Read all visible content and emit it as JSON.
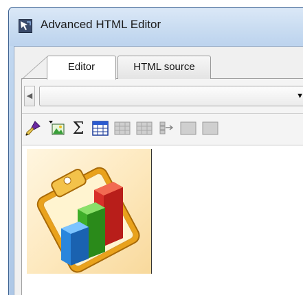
{
  "window": {
    "title": "Advanced HTML Editor"
  },
  "tabs": [
    {
      "label": "Editor",
      "active": true
    },
    {
      "label": "HTML source",
      "active": false
    }
  ],
  "combo": {
    "value": ""
  },
  "toolbar": {
    "buttons": [
      {
        "icon": "brush-icon",
        "enabled": true
      },
      {
        "icon": "insert-image-icon",
        "enabled": true
      },
      {
        "icon": "sigma-icon",
        "enabled": true,
        "glyph": "Σ"
      },
      {
        "icon": "insert-table-icon",
        "enabled": true
      },
      {
        "icon": "table-row-icon",
        "enabled": false
      },
      {
        "icon": "table-column-icon",
        "enabled": false
      },
      {
        "icon": "split-cell-icon",
        "enabled": false
      },
      {
        "icon": "merge-cells-icon",
        "enabled": false
      },
      {
        "icon": "cell-properties-icon",
        "enabled": false
      }
    ]
  },
  "content": {
    "image": "bar-chart-clipboard-icon"
  },
  "colors": {
    "frame": "#b9d1ec",
    "tab_active": "#ffffff",
    "chart_red": "#e53a2a",
    "chart_green": "#4fbf2f",
    "chart_blue": "#2a8fe0"
  }
}
